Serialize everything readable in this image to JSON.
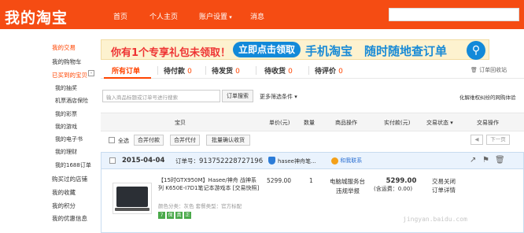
{
  "header": {
    "logo": "我的淘宝",
    "nav": [
      "首页",
      "个人主页",
      "账户设置",
      "消息"
    ]
  },
  "sidebar": {
    "items": [
      {
        "label": "我的交易",
        "style": "red"
      },
      {
        "label": "我的购物车",
        "style": ""
      },
      {
        "label": "已买到的宝贝",
        "style": "red"
      },
      {
        "label": "我的抽奖",
        "style": "sub"
      },
      {
        "label": "机票酒店保险",
        "style": "sub"
      },
      {
        "label": "我的彩票",
        "style": "sub"
      },
      {
        "label": "我的游戏",
        "style": "sub"
      },
      {
        "label": "我的电子书",
        "style": "sub"
      },
      {
        "label": "我的理财",
        "style": "sub"
      },
      {
        "label": "我的1688订单",
        "style": "sub"
      },
      {
        "label": "购买过的店铺",
        "style": ""
      },
      {
        "label": "我的收藏",
        "style": ""
      },
      {
        "label": "我的积分",
        "style": ""
      },
      {
        "label": "我的优惠信息",
        "style": ""
      }
    ],
    "toggle": "-"
  },
  "banner": {
    "text1": "你有1个专享礼包未领取！",
    "button": "立即点击领取",
    "text2": "手机淘宝　随时随地查订单"
  },
  "tabs": {
    "items": [
      {
        "label": "所有订单",
        "count": ""
      },
      {
        "label": "待付款",
        "count": "0"
      },
      {
        "label": "待发货",
        "count": "0"
      },
      {
        "label": "待收货",
        "count": "0"
      },
      {
        "label": "待评价",
        "count": "0"
      }
    ],
    "recycle": "订单回收站"
  },
  "search": {
    "placeholder": "输入商品标题或订单号进行搜索",
    "button": "订单搜索",
    "more": "更多筛选条件",
    "right_text": "化解维权纠纷的网购体验"
  },
  "table": {
    "headers": [
      "宝贝",
      "单价(元)",
      "数量",
      "商品操作",
      "实付款(元)",
      "交易状态",
      "交易操作"
    ]
  },
  "controls": {
    "select_all": "全选",
    "merge_pay": "合并付款",
    "merge_pay2": "合并代付",
    "batch_confirm": "批量确认收货",
    "prev": "上一页",
    "next": "下一页"
  },
  "order": {
    "date": "2015-04-04",
    "number_label": "订单号：",
    "number": "913752228727196",
    "shop": "hasee神舟笔...",
    "chat": "和我联系",
    "title": "【15时GTX950M】Hasee/神舟 战神系列 K650E-I7D1笔记本游戏本 [交易快照]",
    "attr": "颜色分类：灰色  套餐类型：官方标配",
    "price": "5299.00",
    "qty": "1",
    "ops": [
      "电脑城服务台",
      "违规举报"
    ],
    "paid": "5299.00",
    "paid_note": "(含运费：0.00)",
    "status": [
      "交易关闭",
      "订单详情"
    ]
  },
  "watermark": "jingyan.baidu.com"
}
